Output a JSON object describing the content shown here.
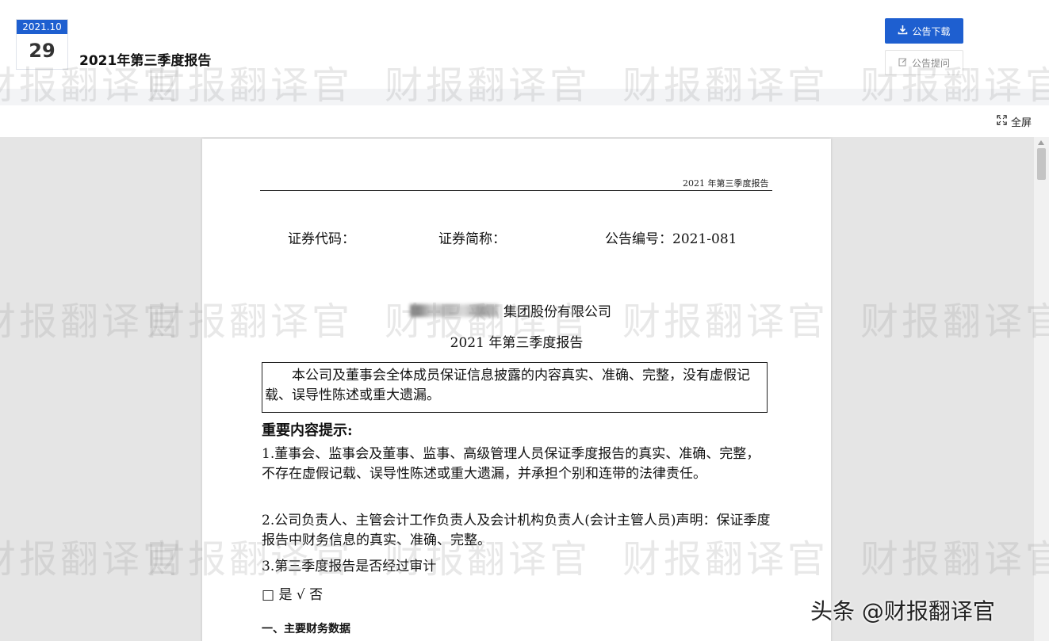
{
  "header": {
    "date_month": "2021.10",
    "date_day": "29",
    "title": "2021年第三季度报告",
    "download_label": "公告下载",
    "ask_label": "公告提问"
  },
  "toolbar": {
    "fullscreen_label": "全屏"
  },
  "document": {
    "running_header": "2021 年第三季度报告",
    "stock_code_label": "证券代码：",
    "stock_name_label": "证券简称：",
    "announcement_no": "公告编号：2021-081",
    "company_name": "集团股份有限公司",
    "report_title": "2021 年第三季度报告",
    "notice": "本公司及董事会全体成员保证信息披露的内容真实、准确、完整，没有虚假记载、误导性陈述或重大遗漏。",
    "important_heading": "重要内容提示:",
    "item1": "1.董事会、监事会及董事、监事、高级管理人员保证季度报告的真实、准确、完整，不存在虚假记载、误导性陈述或重大遗漏，并承担个别和连带的法律责任。",
    "item2": "2.公司负责人、主管会计工作负责人及会计机构负责人(会计主管人员)声明：保证季度报告中财务信息的真实、准确、完整。",
    "item3": "3.第三季度报告是否经过审计",
    "audit_answer": "□ 是 √ 否",
    "section1": "一、主要财务数据"
  },
  "watermark_text": "财报翻译官",
  "source_credit": "头条 @财报翻译官"
}
